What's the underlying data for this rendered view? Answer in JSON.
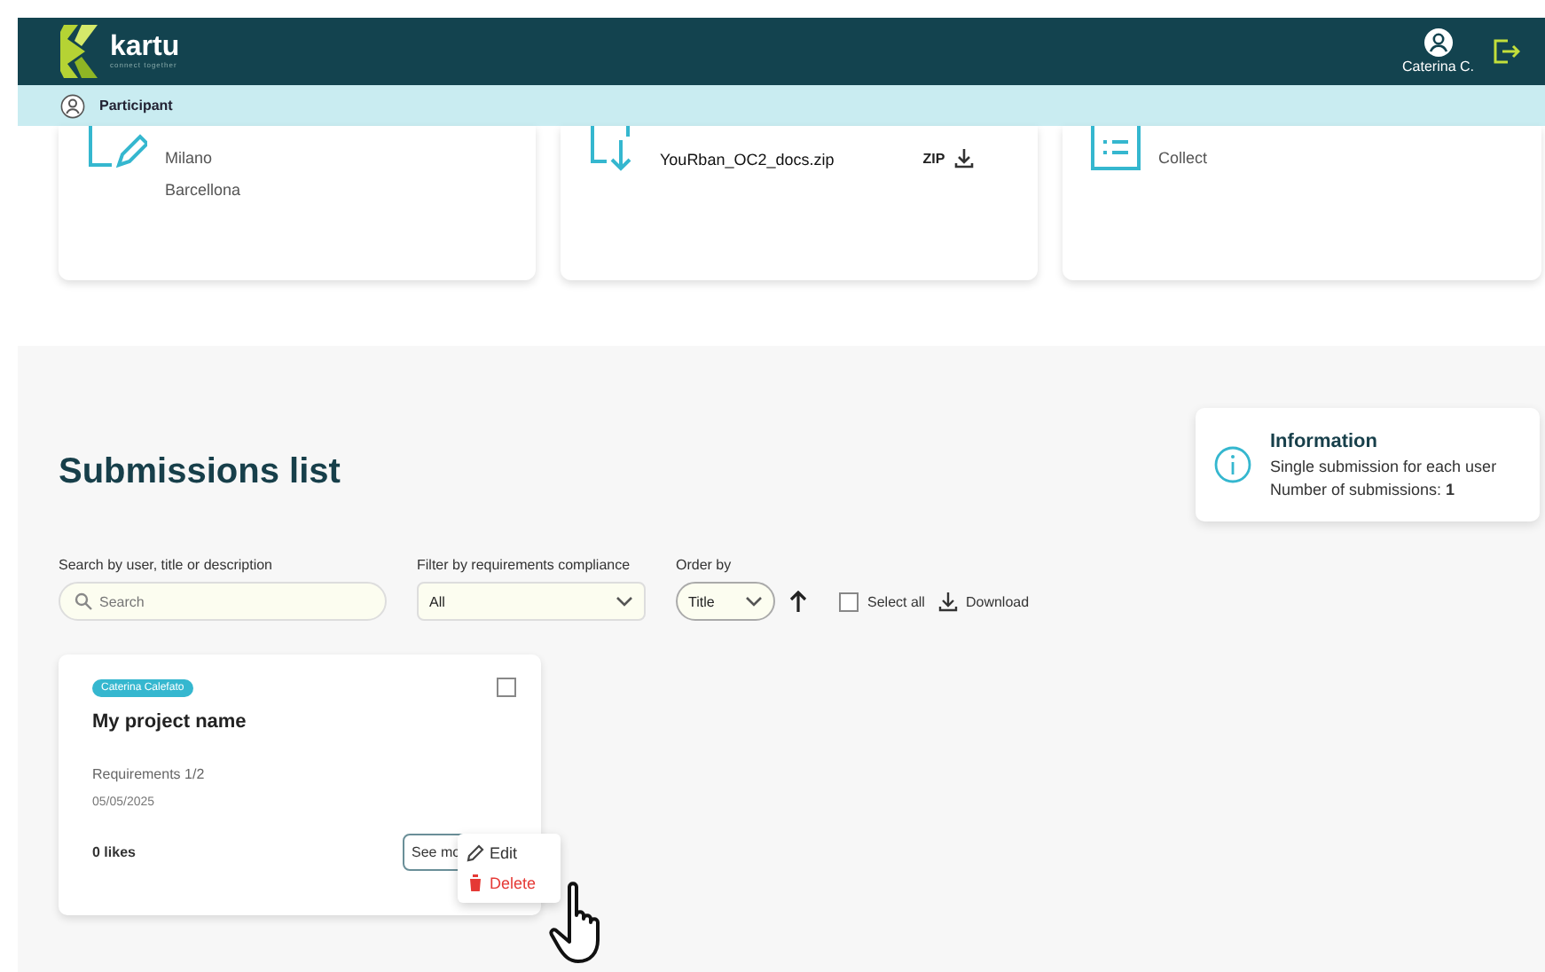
{
  "header": {
    "logo": "kartu",
    "tagline": "connect together",
    "user": "Caterina C."
  },
  "role_bar": {
    "label": "Participant"
  },
  "top_cards": [
    {
      "kind": "edit",
      "lines": [
        "Milano",
        "Barcellona"
      ]
    },
    {
      "kind": "download",
      "file": "YouRban_OC2_docs.zip",
      "format": "ZIP"
    },
    {
      "kind": "list",
      "lines": [
        "Collect"
      ]
    }
  ],
  "section": {
    "title": "Submissions list"
  },
  "info": {
    "title": "Information",
    "line1": "Single submission for each user",
    "line2": "Number of submissions: **1**"
  },
  "filters": {
    "search_label": "Search by user, title or description",
    "search_placeholder": "Search",
    "compliance_label": "Filter by requirements compliance",
    "compliance_value": "All",
    "order_label": "Order by",
    "order_value": "Title",
    "select_all": {
      "label": "Select all",
      "checked": false
    },
    "download": "Download"
  },
  "submissions": [
    {
      "author": "Caterina Calefato",
      "title": "My project name",
      "requirements": "Requirements 1/2",
      "date": "05/05/2025",
      "likes": "0 likes",
      "checked": false,
      "see_more": "See mo"
    }
  ],
  "context_menu": {
    "items": [
      {
        "kind": "edit",
        "label": "Edit"
      },
      {
        "kind": "delete",
        "label": "Delete"
      }
    ]
  }
}
